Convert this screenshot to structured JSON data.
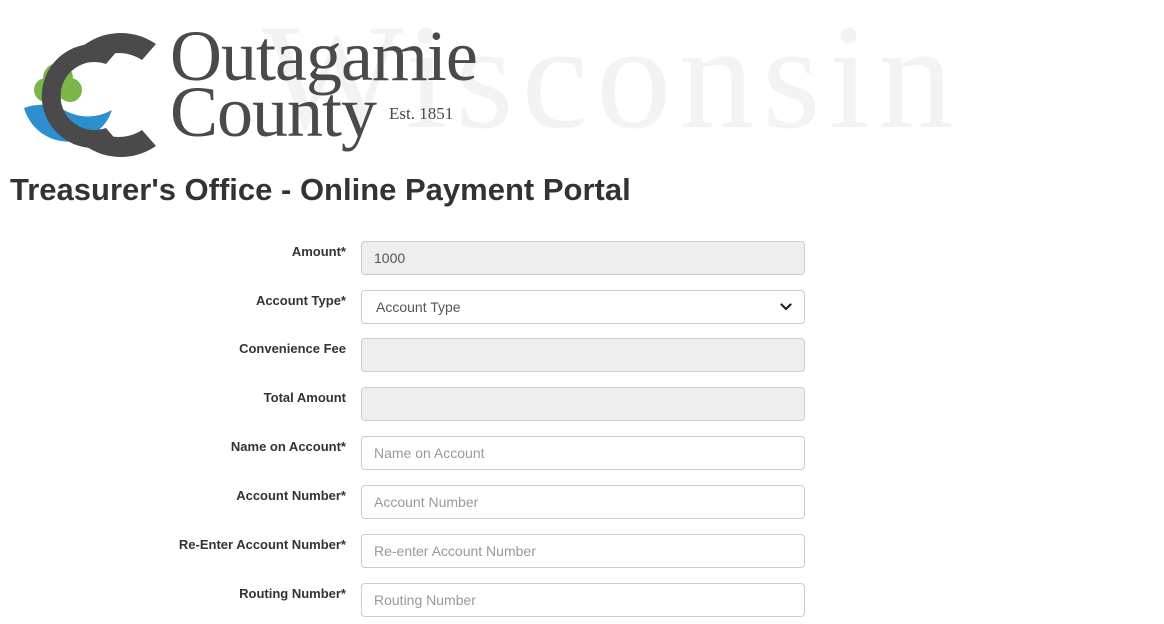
{
  "header": {
    "logo_line1": "Outagamie",
    "logo_line2": "County",
    "logo_est": "Est. 1851",
    "watermark": "Wisconsin",
    "logo_colors": {
      "gray": "#4a4a4d",
      "green": "#7ab648",
      "blue": "#2e8fcf"
    }
  },
  "page": {
    "title": "Treasurer's Office - Online Payment Portal"
  },
  "form": {
    "amount": {
      "label": "Amount*",
      "value": "1000"
    },
    "account_type": {
      "label": "Account Type*",
      "selected": "Account Type",
      "icon": "chevron-down-icon"
    },
    "convenience_fee": {
      "label": "Convenience Fee",
      "value": ""
    },
    "total_amount": {
      "label": "Total Amount",
      "value": ""
    },
    "name_on_account": {
      "label": "Name on Account*",
      "placeholder": "Name on Account"
    },
    "account_number": {
      "label": "Account Number*",
      "placeholder": "Account Number"
    },
    "reenter_account_number": {
      "label": "Re-Enter Account Number*",
      "placeholder": "Re-enter Account Number"
    },
    "routing_number": {
      "label": "Routing Number*",
      "placeholder": "Routing Number"
    }
  }
}
